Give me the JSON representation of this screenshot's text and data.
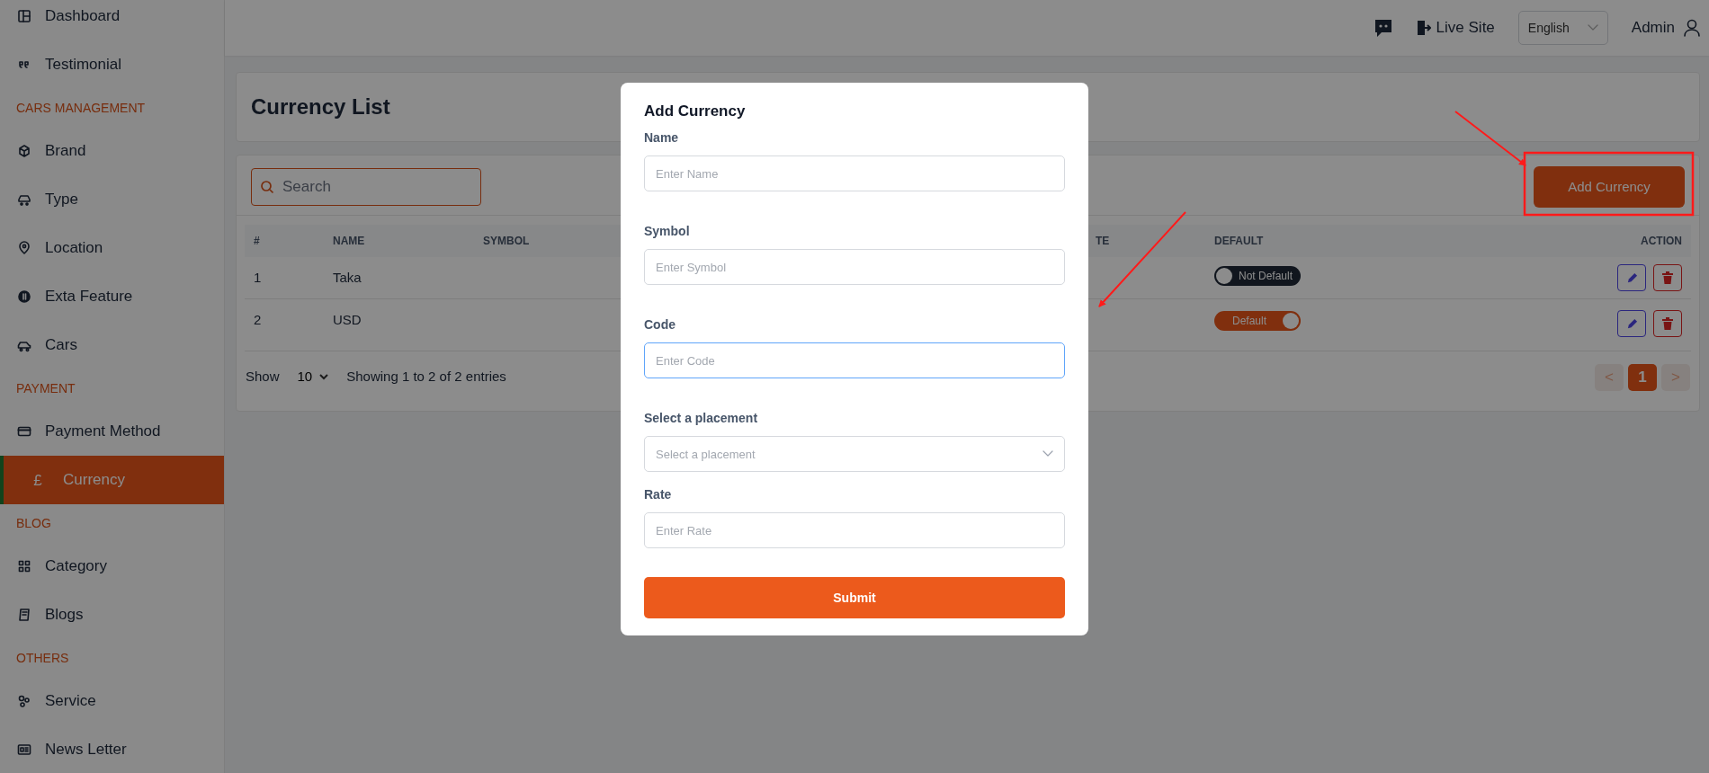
{
  "sidebar": {
    "items": [
      {
        "kind": "link",
        "label": "Dashboard",
        "selected": false
      },
      {
        "kind": "link",
        "label": "Testimonial",
        "selected": false
      },
      {
        "kind": "section",
        "label": "CARS MANAGEMENT"
      },
      {
        "kind": "link",
        "label": "Brand",
        "selected": false
      },
      {
        "kind": "link",
        "label": "Type",
        "selected": false
      },
      {
        "kind": "link",
        "label": "Location",
        "selected": false
      },
      {
        "kind": "link",
        "label": "Exta Feature",
        "selected": false
      },
      {
        "kind": "link",
        "label": "Cars",
        "selected": false
      },
      {
        "kind": "section",
        "label": "PAYMENT"
      },
      {
        "kind": "link",
        "label": "Payment Method",
        "selected": false
      },
      {
        "kind": "link",
        "label": "Currency",
        "selected": true,
        "glyph": "£"
      },
      {
        "kind": "section",
        "label": "BLOG"
      },
      {
        "kind": "link",
        "label": "Category",
        "selected": false
      },
      {
        "kind": "link",
        "label": "Blogs",
        "selected": false
      },
      {
        "kind": "section",
        "label": "OTHERS"
      },
      {
        "kind": "link",
        "label": "Service",
        "selected": false
      },
      {
        "kind": "link",
        "label": "News Letter",
        "selected": false
      }
    ]
  },
  "topbar": {
    "live_site": "Live Site",
    "language": "English",
    "user": "Admin"
  },
  "page_title": "Currency List",
  "search": {
    "placeholder": "Search"
  },
  "add_button": "Add Currency",
  "table": {
    "columns": [
      "#",
      "NAME",
      "SYMBOL",
      "TE",
      "DEFAULT",
      "ACTION"
    ],
    "rows": [
      {
        "index": "1",
        "name": "Taka",
        "default": {
          "label": "Not Default",
          "on": false
        }
      },
      {
        "index": "2",
        "name": "USD",
        "default": {
          "label": "Default",
          "on": true
        }
      }
    ]
  },
  "footer": {
    "show_label": "Show",
    "page_size": "10",
    "summary": "Showing 1 to 2 of 2 entries",
    "pagination": {
      "prev": {
        "label": "<",
        "disabled": true
      },
      "pages": [
        {
          "label": "1",
          "selected": true
        }
      ],
      "next": {
        "label": ">",
        "disabled": true
      }
    }
  },
  "modal": {
    "title": "Add Currency",
    "fields": [
      {
        "kind": "text",
        "label": "Name",
        "placeholder": "Enter Name",
        "focused": false
      },
      {
        "kind": "text",
        "label": "Symbol",
        "placeholder": "Enter Symbol",
        "focused": false
      },
      {
        "kind": "text",
        "label": "Code",
        "placeholder": "Enter Code",
        "focused": true
      },
      {
        "kind": "select",
        "label": "Select a placement",
        "placeholder": "Select a placement",
        "focused": false
      },
      {
        "kind": "text",
        "label": "Rate",
        "placeholder": "Enter Rate",
        "focused": false
      }
    ],
    "submit": "Submit"
  }
}
